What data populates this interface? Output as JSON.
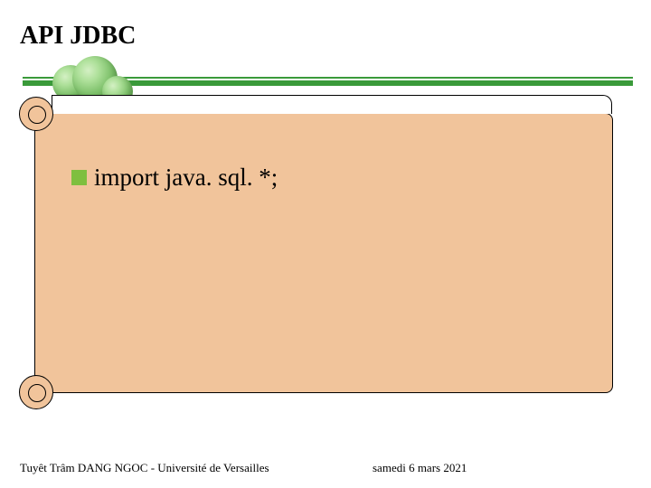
{
  "title": "API JDBC",
  "content": {
    "bullets": [
      {
        "text": "import java. sql. *;"
      }
    ]
  },
  "footer": {
    "author": "Tuyêt Trâm DANG NGOC - Université de Versailles",
    "date": "samedi 6 mars 2021"
  },
  "colors": {
    "accent_green": "#3a9a3a",
    "bullet_green": "#7fbf3f",
    "scroll_fill": "#f1c49b"
  }
}
